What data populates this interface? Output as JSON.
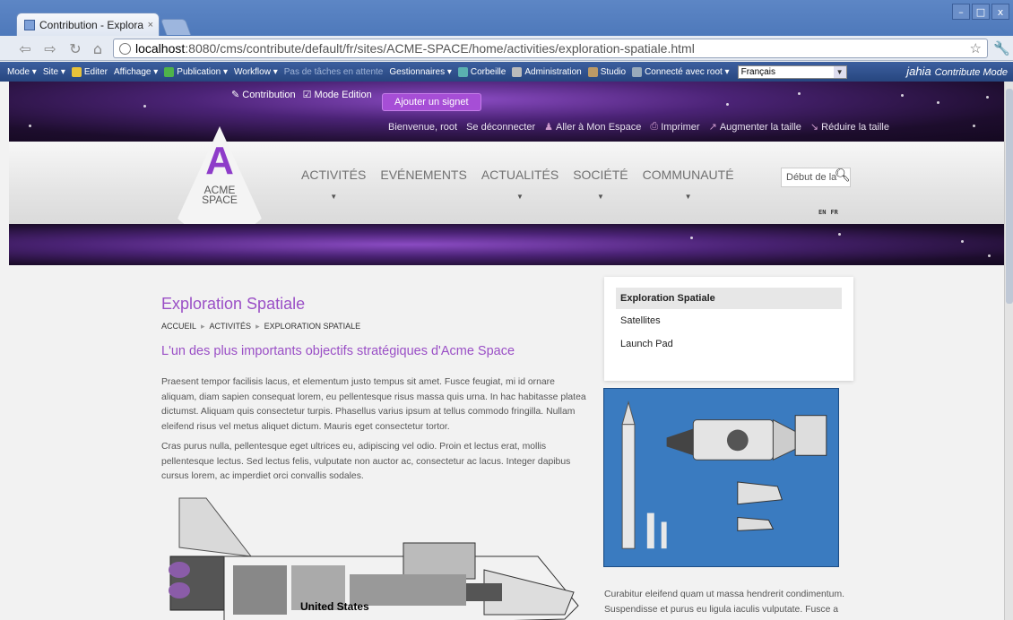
{
  "browser": {
    "tab_title": "Contribution - Explorati",
    "tab_close": "×",
    "url_host": "localhost",
    "url_path": ":8080/cms/contribute/default/fr/sites/ACME-SPACE/home/activities/exploration-spatiale.html",
    "window_controls": [
      "–",
      "□",
      "x"
    ]
  },
  "jahia_bar": {
    "items": [
      {
        "label": "Mode ▾",
        "dim": false
      },
      {
        "label": "Site ▾",
        "dim": false
      },
      {
        "label": "Editer",
        "icon": "edit-icon",
        "dim": false
      },
      {
        "label": "Affichage ▾",
        "dim": false
      },
      {
        "label": "Publication ▾",
        "icon": "publish-icon",
        "dim": false
      },
      {
        "label": "Workflow ▾",
        "dim": false
      },
      {
        "label": "Pas de tâches en attente",
        "dim": true
      },
      {
        "label": "Gestionnaires ▾",
        "dim": false
      },
      {
        "label": "Corbeille",
        "icon": "trash-icon",
        "dim": false
      },
      {
        "label": "Administration",
        "icon": "admin-icon",
        "dim": false
      },
      {
        "label": "Studio",
        "icon": "studio-icon",
        "dim": false
      },
      {
        "label": "Connecté avec root ▾",
        "icon": "user-icon",
        "dim": false
      }
    ],
    "language_value": "Français",
    "brand": "jahia",
    "mode": "Contribute Mode",
    "colors": {
      "bar": "#2f4f8f",
      "accent": "#9a4fc6"
    }
  },
  "site_header": {
    "contribution": "Contribution",
    "mode_edition": "Mode Edition",
    "bookmark_button": "Ajouter un signet",
    "welcome": "Bienvenue, root",
    "links": [
      "Se déconnecter",
      "Aller à Mon Espace",
      "Imprimer",
      "Augmenter la taille",
      "Réduire la taille"
    ],
    "logo_letter": "A",
    "logo_line1": "ACME",
    "logo_line2": "SPACE",
    "nav": [
      "ACTIVITÉS",
      "EVÉNEMENTS",
      "ACTUALITÉS",
      "SOCIÉTÉ",
      "COMMUNAUTÉ"
    ],
    "search_placeholder": "Début de la",
    "langs": [
      "EN",
      "FR"
    ]
  },
  "content": {
    "title": "Exploration Spatiale",
    "breadcrumb": [
      "ACCUEIL",
      "ACTIVITÉS",
      "EXPLORATION SPATIALE"
    ],
    "subtitle": "L'un des plus importants objectifs stratégiques d'Acme Space",
    "para1": "Praesent tempor facilisis lacus, et elementum justo tempus sit amet. Fusce feugiat, mi id ornare aliquam, diam sapien consequat lorem, eu pellentesque risus massa quis urna. In hac habitasse platea dictumst. Aliquam quis consectetur turpis. Phasellus varius ipsum at tellus commodo fringilla. Nullam eleifend risus vel metus aliquet dictum. Mauris eget consectetur tortor.",
    "para2": "Cras purus nulla, pellentesque eget ultrices eu, adipiscing vel odio. Proin et lectus erat, mollis pellentesque lectus. Sed lectus felis, vulputate non auctor ac, consectetur ac lacus. Integer dapibus cursus lorem, ac imperdiet orci convallis sodales.",
    "shuttle_label": "United States"
  },
  "sidebar": {
    "items": [
      "Exploration Spatiale",
      "Satellites",
      "Launch Pad"
    ],
    "text": "Curabitur eleifend quam ut massa hendrerit condimentum. Suspendisse et purus eu ligula iaculis vulputate. Fusce a"
  }
}
